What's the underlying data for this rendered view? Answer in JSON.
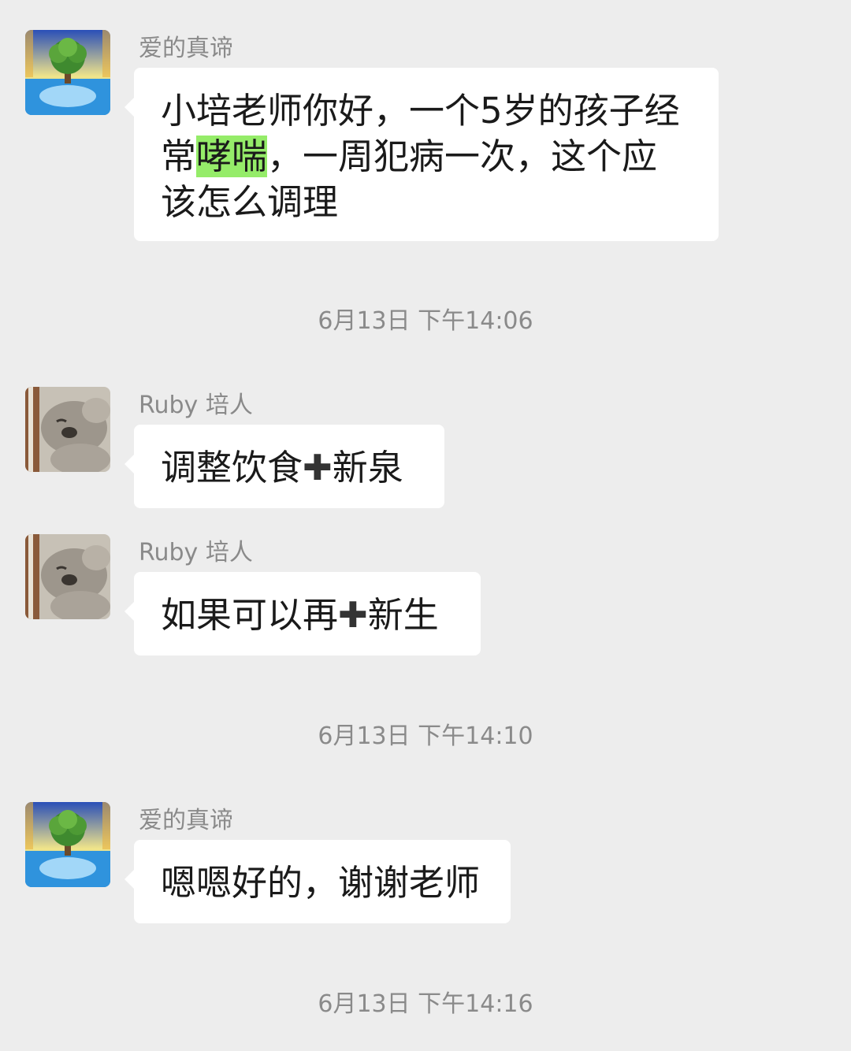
{
  "messages": [
    {
      "sender": "爱的真谛",
      "avatar_icon": "tree-of-life-icon",
      "text_before": "小培老师你好，一个5岁的孩子经常",
      "text_highlight": "哮喘",
      "text_after": "，一周犯病一次，这个应该怎么调理"
    },
    {
      "sender": "Ruby 培人",
      "avatar_icon": "koala-icon",
      "text_before": "调整饮食",
      "plus": "✚",
      "text_after": "新泉"
    },
    {
      "sender": "Ruby 培人",
      "avatar_icon": "koala-icon",
      "text_before": "如果可以再",
      "plus": "✚",
      "text_after": "新生"
    },
    {
      "sender": "爱的真谛",
      "avatar_icon": "tree-of-life-icon",
      "text": "嗯嗯好的，谢谢老师"
    }
  ],
  "timestamps": [
    "6月13日 下午14:06",
    "6月13日 下午14:10",
    "6月13日 下午14:16"
  ],
  "colors": {
    "background": "#ededed",
    "bubble": "#ffffff",
    "highlight": "#95ec69",
    "meta_text": "#8a8a8a"
  }
}
